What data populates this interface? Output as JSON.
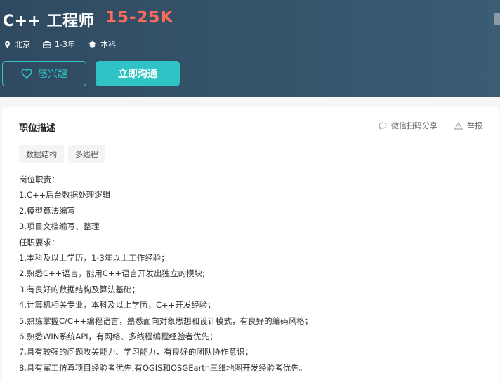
{
  "header": {
    "job_title": "C++ 工程师",
    "salary": "15-25K",
    "meta": {
      "location": "北京",
      "experience": "1-3年",
      "education": "本科"
    },
    "buttons": {
      "interest_label": "感兴趣",
      "chat_label": "立即沟通"
    }
  },
  "job_detail": {
    "section_title": "职位描述",
    "share_label": "微信扫码分享",
    "report_label": "举报",
    "tags": [
      "数据结构",
      "多线程"
    ],
    "description_lines": [
      "岗位职责：",
      "1.C++后台数据处理逻辑",
      "2.模型算法编写",
      "3.项目文档编写、整理",
      "任职要求：",
      "1.本科及以上学历，1-3年以上工作经验；",
      "2.熟悉C++语言，能用C++语言开发出独立的模块;",
      "3.有良好的数据结构及算法基础；",
      "4.计算机相关专业，本科及以上学历，C++开发经验；",
      "5.熟练掌握C/C++编程语言，熟悉面向对象思想和设计模式，有良好的编码风格；",
      "6.熟悉WIN系统API，有网络、多线程编程经验者优先；",
      "7.具有较强的问题攻关能力、学习能力，有良好的团队协作意识；",
      "8.具有军工仿真项目经验者优先;有QGIS和OSGEarth三维地图开发经验者优先。"
    ]
  },
  "colors": {
    "header_bg": "#2f4a60",
    "salary": "#ff6b5a",
    "accent": "#2fc3c5"
  }
}
